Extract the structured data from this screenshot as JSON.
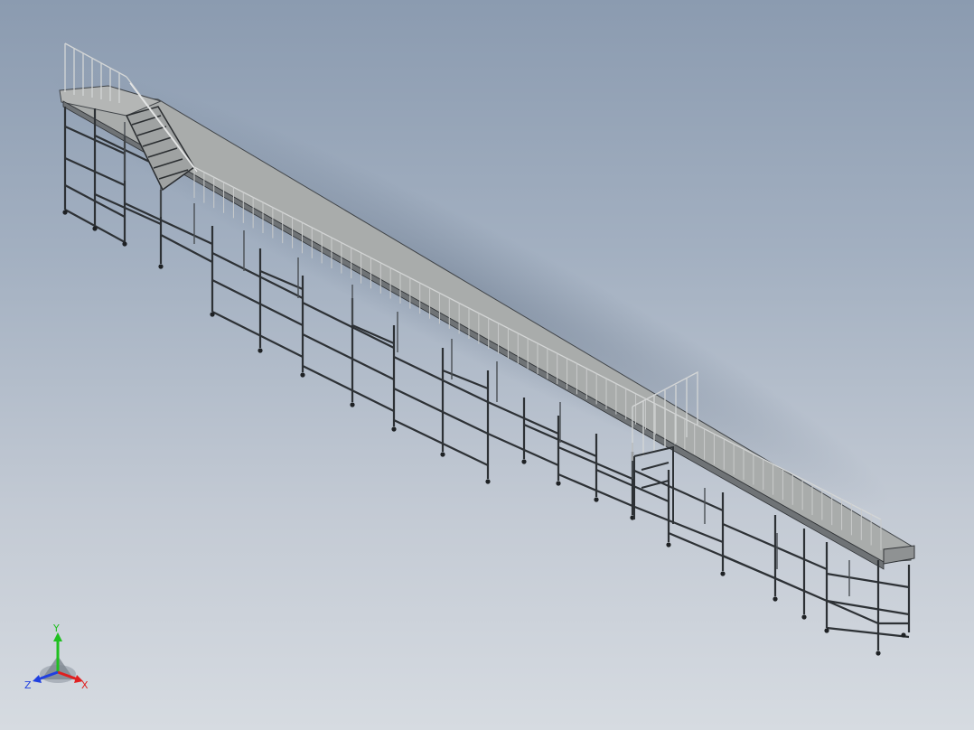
{
  "viewport": {
    "background_top": "#8b9bb0",
    "background_bottom": "#d6dbe1",
    "model": "steel-frame-walkway-platform-with-stairs"
  },
  "triad": {
    "x_label": "X",
    "y_label": "Y",
    "z_label": "Z",
    "x_color": "#e02020",
    "y_color": "#20c020",
    "z_color": "#2040e0"
  }
}
